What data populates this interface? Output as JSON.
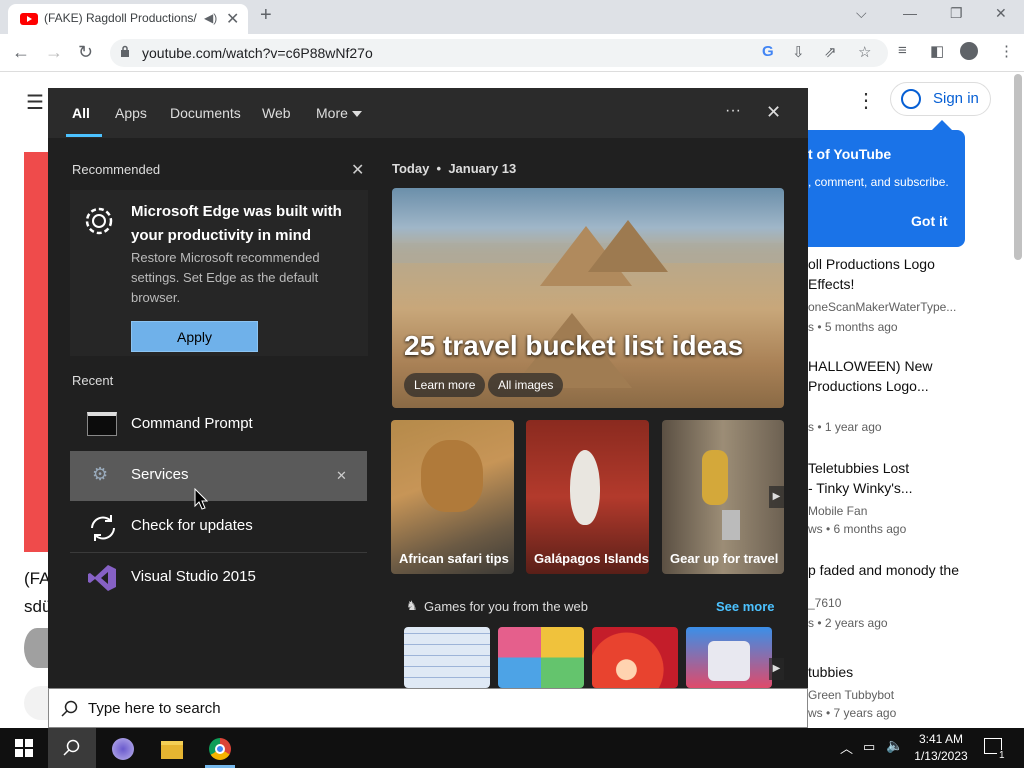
{
  "browser": {
    "tab_title": "(FAKE) Ragdoll Productions/",
    "url": "youtube.com/watch?v=c6P88wNf27o",
    "new_tab": "+",
    "tab_close": "✕"
  },
  "youtube": {
    "signin": "Sign in",
    "bubble_title": "t of YouTube",
    "bubble_text": ", comment, and subscribe.",
    "bubble_btn": "Got it",
    "left_text1": "(FA",
    "left_text2": "sdü",
    "videos": [
      {
        "title1": "oll Productions Logo",
        "title2": "Effects!",
        "channel": "oneScanMakerWaterType...",
        "meta": "s  • 5 months ago"
      },
      {
        "title1": " HALLOWEEN) New",
        "title2": "Productions Logo...",
        "channel": "",
        "meta": "s  • 1 year ago"
      },
      {
        "title1": "Teletubbies Lost",
        "title2": "- Tinky Winky's...",
        "channel": "Mobile Fan",
        "meta": "ws  • 6 months ago"
      },
      {
        "title1": "p faded and monody the",
        "title2": "",
        "channel": "_7610",
        "meta": "s  • 2 years ago"
      },
      {
        "title1": "tubbies",
        "title2": "",
        "channel": "Green Tubbybot",
        "meta": "ws  • 7 years ago"
      }
    ]
  },
  "start_menu": {
    "tabs": [
      "All",
      "Apps",
      "Documents",
      "Web",
      "More"
    ],
    "more_dots": "···",
    "close": "✕",
    "recommended_label": "Recommended",
    "rec_title": "Microsoft Edge was built with your productivity in mind",
    "rec_body": "Restore Microsoft recommended settings. Set Edge as the default browser.",
    "apply": "Apply",
    "recent_label": "Recent",
    "recent": [
      "Command Prompt",
      "Services",
      "Check for updates",
      "Visual Studio 2015"
    ],
    "today": "Today  •  January 13",
    "hero_title": "25 travel bucket list ideas",
    "hero_btn1": "Learn more",
    "hero_btn2": "All images",
    "thumbs": [
      "African safari tips",
      "Galápagos Islands",
      "Gear up for travel"
    ],
    "games_label": "Games for you from the web",
    "see_more": "See more",
    "search_placeholder": "Type here to search"
  },
  "taskbar": {
    "time": "3:41 AM",
    "date": "1/13/2023",
    "notif_count": "1"
  }
}
